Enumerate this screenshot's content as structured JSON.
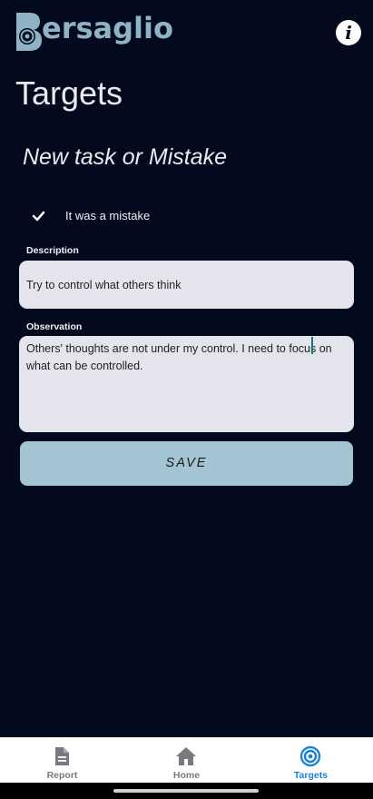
{
  "header": {
    "logo_text": "ersaglio",
    "logo_full": "Bersaglio",
    "info_label": "i",
    "info_icon": "info-icon"
  },
  "page": {
    "title": "Targets",
    "form_title": "New task or Mistake"
  },
  "form": {
    "mistake_checkbox": {
      "label": "It was a mistake",
      "checked": true,
      "icon": "check-icon"
    },
    "description": {
      "label": "Description",
      "value": "Try to control what others think"
    },
    "observation": {
      "label": "Observation",
      "value": "Others' thoughts are not under my control. I need to focus on what can be controlled."
    },
    "save_label": "SAVE"
  },
  "bottom_nav": {
    "items": [
      {
        "label": "Report",
        "icon": "report-document-icon",
        "active": false
      },
      {
        "label": "Home",
        "icon": "home-icon",
        "active": false
      },
      {
        "label": "Targets",
        "icon": "target-icon",
        "active": true
      }
    ]
  },
  "colors": {
    "background": "#030a1d",
    "accent": "#a2c4d3",
    "logo": "#8fb3c4",
    "active_nav": "#1b83d6",
    "field_bg": "#e4e4ec"
  }
}
